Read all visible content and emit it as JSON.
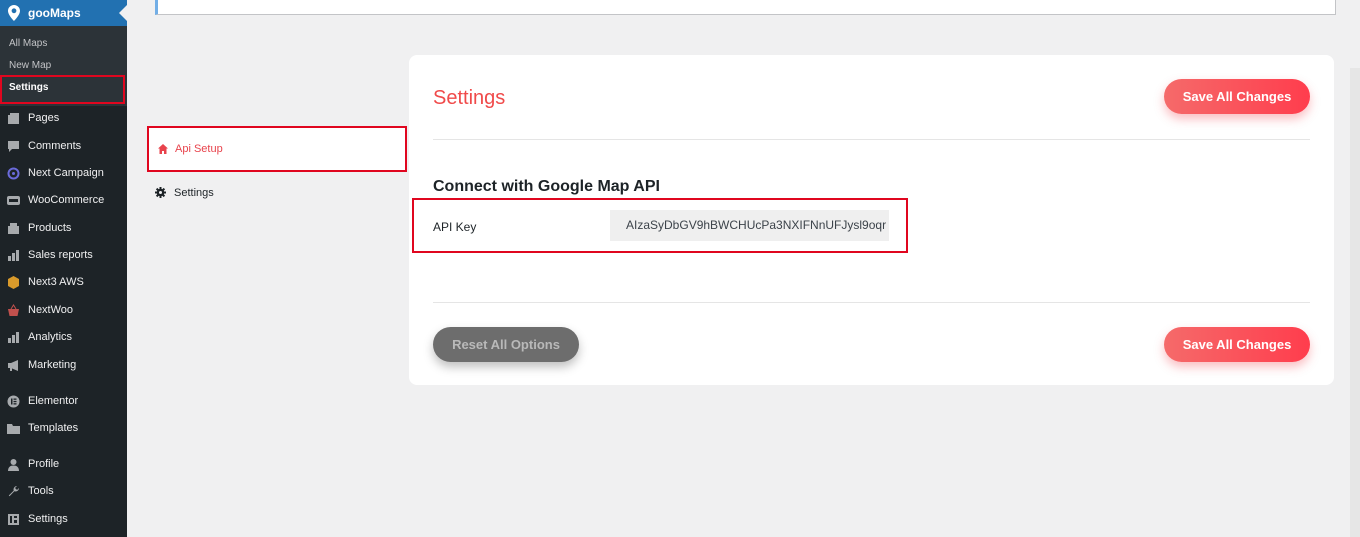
{
  "sidebar": {
    "plugin_title": "gooMaps",
    "submenu": [
      {
        "label": "All Maps",
        "current": false
      },
      {
        "label": "New Map",
        "current": false
      },
      {
        "label": "Settings",
        "current": true
      }
    ],
    "items": [
      {
        "label": "Pages",
        "icon": "pages-icon"
      },
      {
        "label": "Comments",
        "icon": "comments-icon"
      },
      {
        "label": "Next Campaign",
        "icon": "campaign-icon"
      },
      {
        "label": "WooCommerce",
        "icon": "woocommerce-icon"
      },
      {
        "label": "Products",
        "icon": "products-icon"
      },
      {
        "label": "Sales reports",
        "icon": "bar-chart-icon"
      },
      {
        "label": "Next3 AWS",
        "icon": "aws-icon"
      },
      {
        "label": "NextWoo",
        "icon": "basket-icon"
      },
      {
        "label": "Analytics",
        "icon": "analytics-icon"
      },
      {
        "label": "Marketing",
        "icon": "megaphone-icon"
      },
      {
        "label": "Elementor",
        "icon": "elementor-icon"
      },
      {
        "label": "Templates",
        "icon": "folder-icon"
      },
      {
        "label": "Profile",
        "icon": "user-icon"
      },
      {
        "label": "Tools",
        "icon": "wrench-icon"
      },
      {
        "label": "Settings",
        "icon": "settings-icon"
      }
    ]
  },
  "tabs": [
    {
      "label": "Api Setup",
      "icon": "home-icon",
      "active": true
    },
    {
      "label": "Settings",
      "icon": "gear-icon",
      "active": false
    }
  ],
  "main": {
    "title": "Settings",
    "save_label": "Save All Changes",
    "reset_label": "Reset All Options",
    "section_title": "Connect with Google Map API",
    "api_key_label": "API Key",
    "api_key_value": "AIzaSyDbGV9hBWCHUcPa3NXIFNnUFJysl9oqr"
  },
  "colors": {
    "accent": "#f04a4a",
    "highlight_border": "#e0061f",
    "sidebar_bg": "#1d2327",
    "menu_active": "#2271b1"
  }
}
